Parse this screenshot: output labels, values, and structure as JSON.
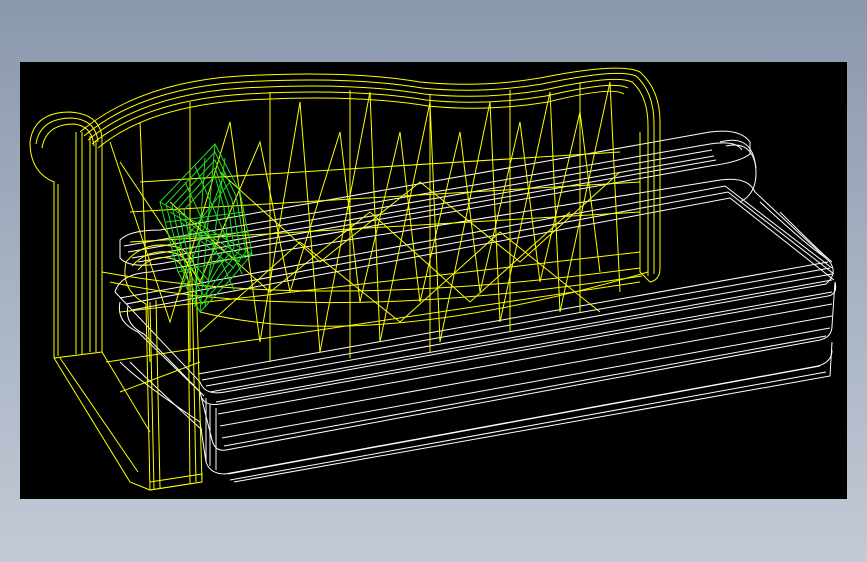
{
  "colors": {
    "background_top": "#8a98ad",
    "background_bottom": "#c3cad6",
    "viewport_background": "#000000",
    "sofa_frame": "#ffff00",
    "cushions_base": "#ffffff",
    "pillow": "#22dd22"
  },
  "model": {
    "parts": [
      "sofa-frame",
      "seat-cushions",
      "base-platform",
      "throw-pillow"
    ],
    "render_mode": "wireframe"
  }
}
